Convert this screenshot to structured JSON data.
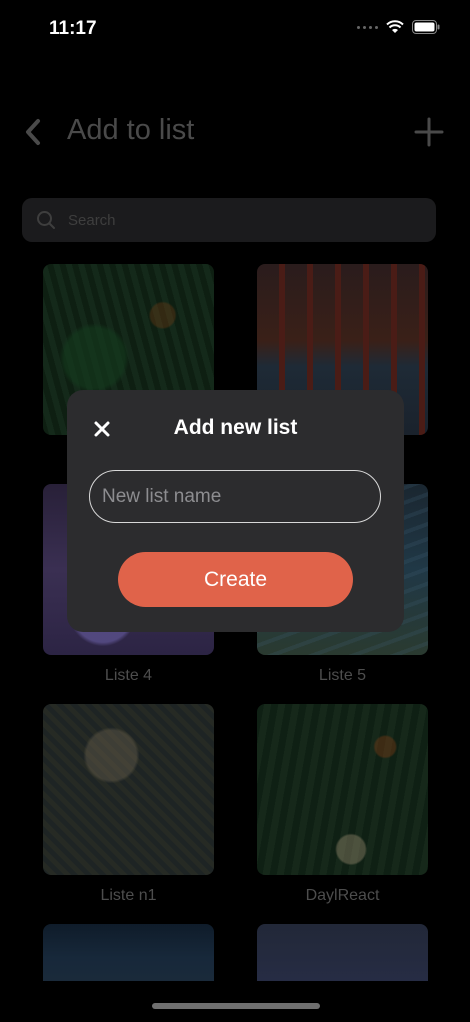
{
  "status_bar": {
    "time": "11:17"
  },
  "header": {
    "title": "Add to list"
  },
  "search": {
    "placeholder": "Search"
  },
  "lists": [
    {
      "label": ""
    },
    {
      "label": ""
    },
    {
      "label": "Liste 4"
    },
    {
      "label": "Liste 5"
    },
    {
      "label": "Liste n1"
    },
    {
      "label": "DaylReact"
    },
    {
      "label": ""
    },
    {
      "label": ""
    }
  ],
  "modal": {
    "title": "Add new list",
    "input_placeholder": "New list name",
    "create_label": "Create"
  },
  "colors": {
    "accent": "#e0634a",
    "modal_bg": "#2c2c2e",
    "background": "#000000"
  }
}
